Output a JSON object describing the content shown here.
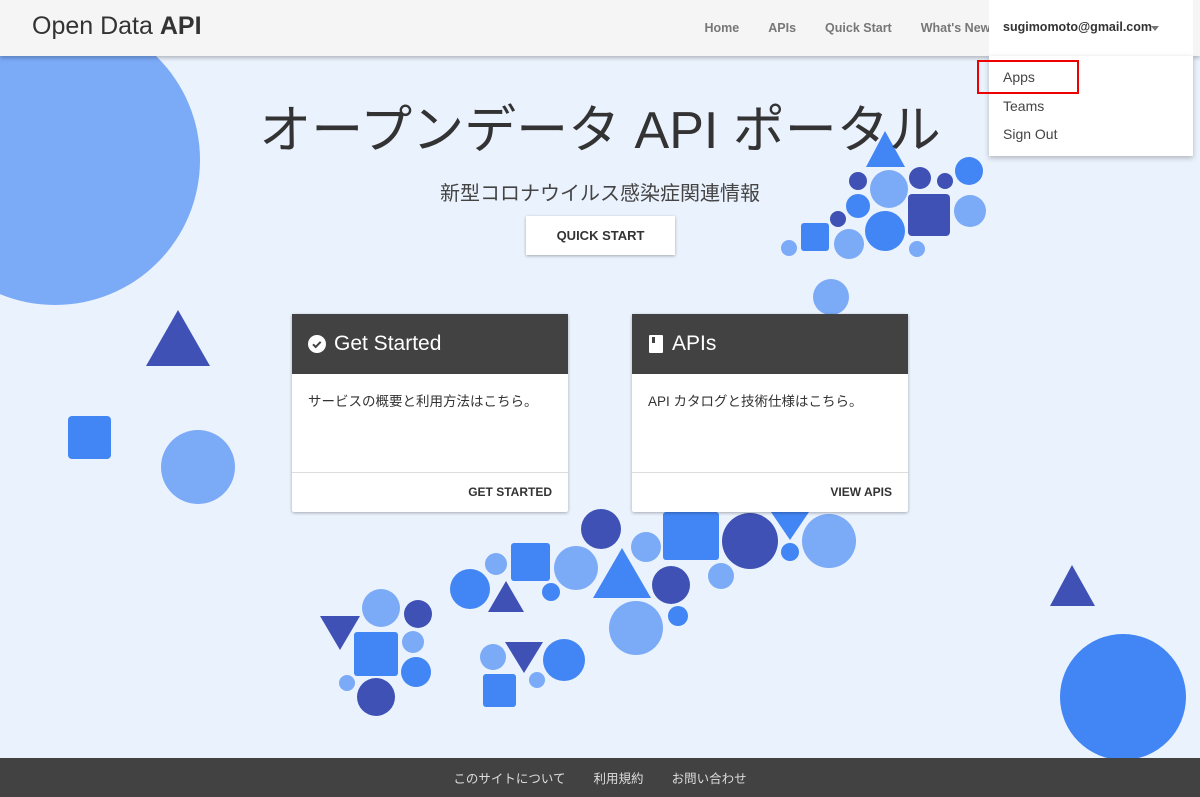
{
  "brand": {
    "light": "Open Data ",
    "bold": "API"
  },
  "nav": {
    "links": [
      "Home",
      "APIs",
      "Quick Start",
      "What's New"
    ],
    "user": "sugimomoto@gmail.com"
  },
  "user_menu": [
    "Apps",
    "Teams",
    "Sign Out"
  ],
  "hero": {
    "title": "オープンデータ API ポータル",
    "subtitle": "新型コロナウイルス感染症関連情報",
    "button": "QUICK START"
  },
  "cards": [
    {
      "title": "Get Started",
      "icon": "check-circle-icon",
      "body": "サービスの概要と利用方法はこちら。",
      "action": "GET STARTED"
    },
    {
      "title": "APIs",
      "icon": "book-icon",
      "body": "API カタログと技術仕様はこちら。",
      "action": "VIEW APIS"
    }
  ],
  "footer": [
    "このサイトについて",
    "利用規約",
    "お問い合わせ"
  ],
  "colors": {
    "light": "#7baaf7",
    "blue": "#4285f4",
    "indigo": "#3f51b5",
    "highlight": "#e00000"
  }
}
